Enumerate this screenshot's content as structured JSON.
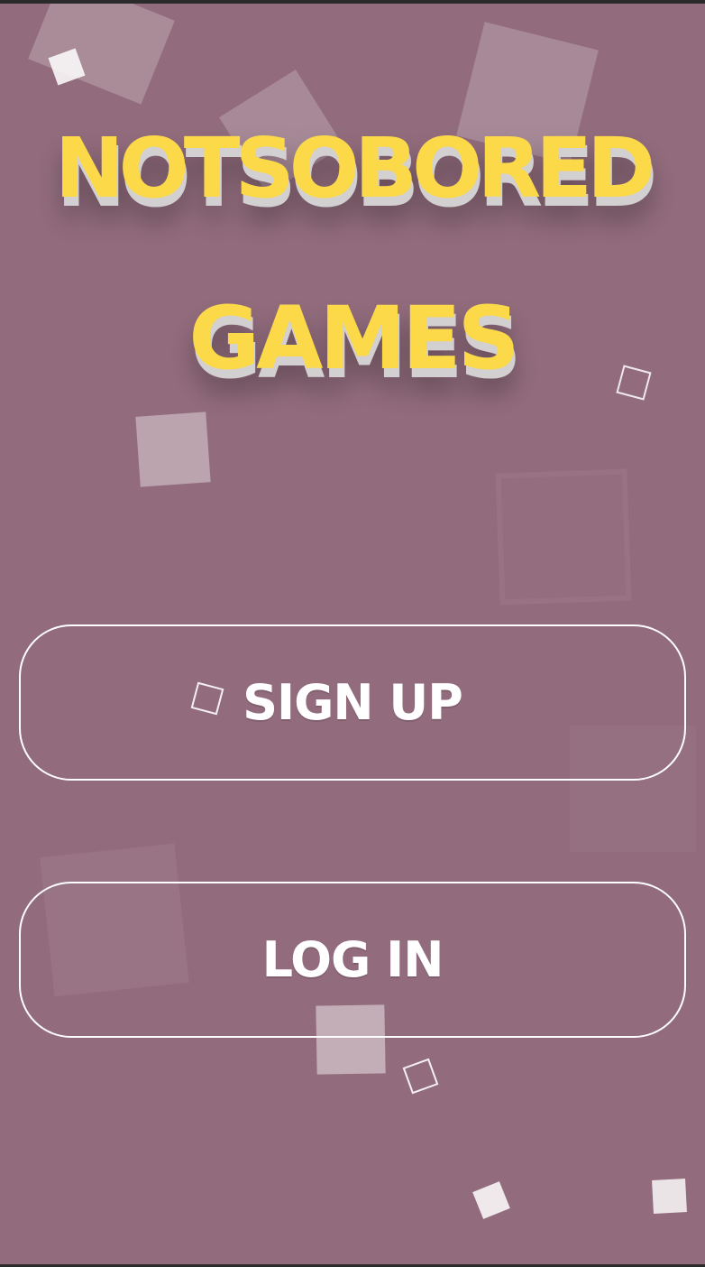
{
  "app": {
    "logo_line1": "NOTSOBORED",
    "logo_line2": "GAMES",
    "logo_color": "#fbd94a",
    "logo_side_color": "#d2d0d0",
    "background_color": "#926c7d"
  },
  "actions": {
    "signup_label": "SIGN UP",
    "login_label": "LOG IN"
  }
}
